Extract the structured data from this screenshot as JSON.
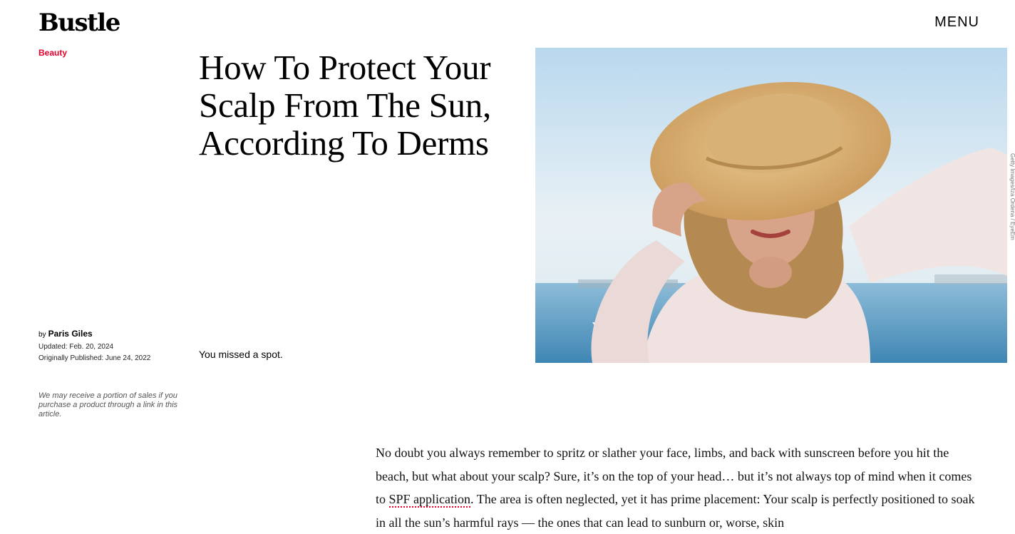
{
  "header": {
    "logo": "Bustle",
    "menu_label": "MENU"
  },
  "article": {
    "category": "Beauty",
    "title": "How To Protect Your Scalp From The Sun, According To Derms",
    "subtitle": "You missed a spot.",
    "byline_prefix": "by",
    "author": "Paris Giles",
    "updated": "Updated: Feb. 20, 2024",
    "originally_published": "Originally Published: June 24, 2022",
    "disclaimer": "We may receive a portion of sales if you purchase a product through a link in this article.",
    "image_credit": "Getty Images/Iza Ordena / EyeEm",
    "body": {
      "part1": "No doubt you always remember to spritz or slather your face, limbs, and back with sunscreen before you hit the beach, but what about your scalp? Sure, it’s on the top of your head… but it’s not always top of mind when it comes to ",
      "link": "SPF application",
      "part2": ". The area is often neglected, yet it has prime placement: Your scalp is perfectly positioned to soak in all the sun’s harmful rays — the ones that can lead to sunburn or, worse, skin"
    }
  },
  "colors": {
    "accent": "#e4002b"
  }
}
